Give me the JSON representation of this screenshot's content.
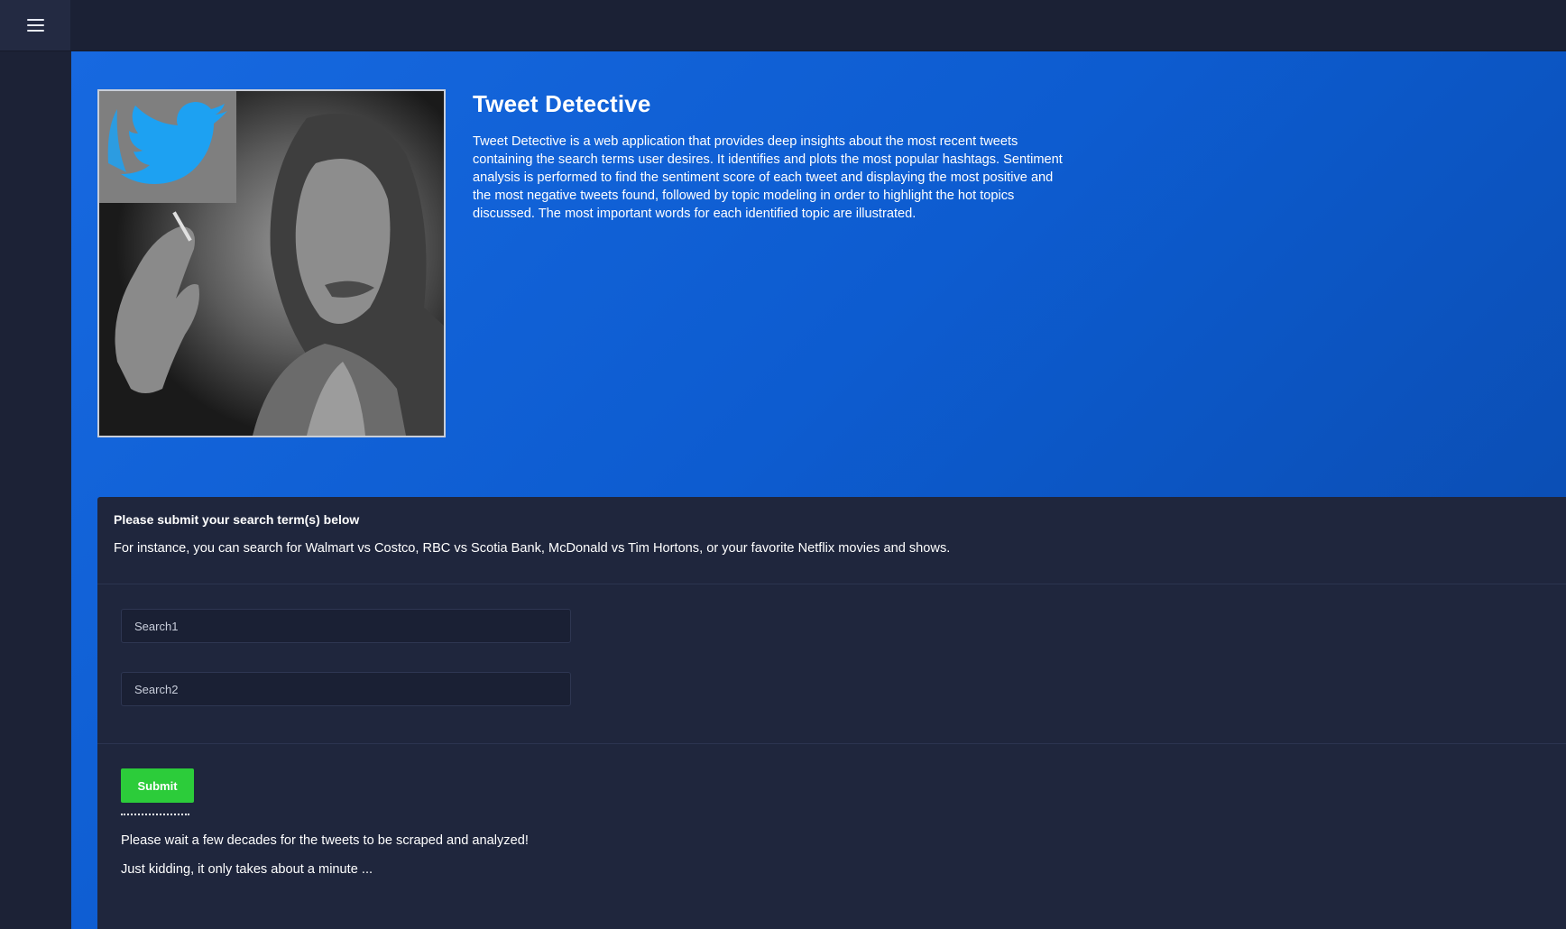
{
  "header": {
    "menu_icon": "hamburger-menu-icon"
  },
  "hero": {
    "title": "Tweet Detective",
    "description": "Tweet Detective is a web application that provides deep insights about the most recent tweets containing the search terms user desires. It identifies and plots the most popular hashtags. Sentiment analysis is performed to find the sentiment score of each tweet and displaying the most positive and the most negative tweets found, followed by topic modeling in order to highlight the hot topics discussed. The most important words for each identified topic are illustrated.",
    "image_icon": "twitter-bird-icon"
  },
  "search_card": {
    "title": "Please submit your search term(s) below",
    "subtitle": "For instance, you can search for Walmart vs Costco, RBC vs Scotia Bank, McDonald vs Tim Hortons, or your favorite Netflix movies and shows.",
    "search1_placeholder": "Search1",
    "search2_placeholder": "Search2",
    "submit_label": "Submit",
    "dots": "........................",
    "wait_message": "Please wait a few decades for the tweets to be scraped and analyzed!",
    "wait_message_2": "Just kidding, it only takes about a minute ..."
  },
  "colors": {
    "accent_blue": "#1769e0",
    "submit_green": "#2ccc3a",
    "sidebar_bg": "#1c2236",
    "card_bg": "#1f263d",
    "twitter_blue": "#1da1f2"
  }
}
